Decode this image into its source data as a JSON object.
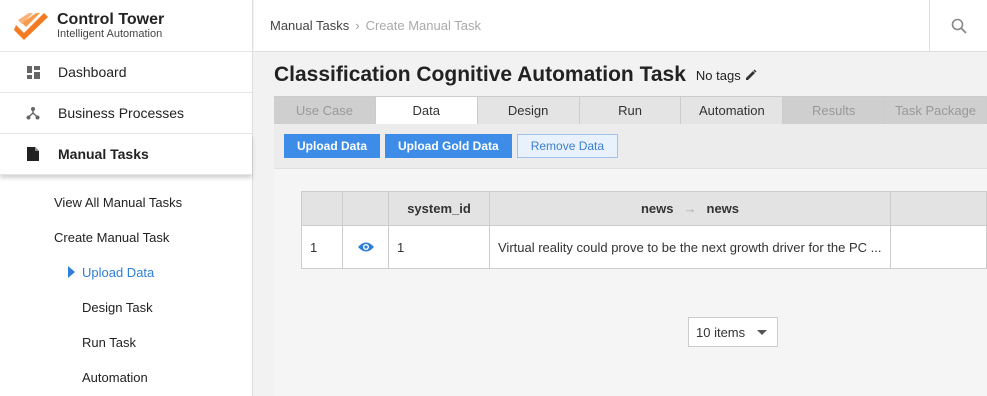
{
  "brand": {
    "name": "Control Tower",
    "tagline": "Intelligent Automation"
  },
  "nav": [
    {
      "label": "Dashboard",
      "icon": "dashboard-icon"
    },
    {
      "label": "Business Processes",
      "icon": "process-icon"
    },
    {
      "label": "Manual Tasks",
      "icon": "document-icon"
    }
  ],
  "subnav": {
    "view_all": "View All Manual Tasks",
    "create": "Create Manual Task",
    "upload": "Upload Data",
    "design": "Design Task",
    "run": "Run Task",
    "automation": "Automation"
  },
  "breadcrumb": {
    "root": "Manual Tasks",
    "current": "Create Manual Task"
  },
  "page": {
    "title": "Classification Cognitive Automation Task",
    "tags": "No tags"
  },
  "tabs": [
    "Use Case",
    "Data",
    "Design",
    "Run",
    "Automation",
    "Results",
    "Task Package"
  ],
  "buttons": {
    "upload": "Upload Data",
    "upload_gold": "Upload Gold Data",
    "remove": "Remove Data"
  },
  "grid": {
    "headers": {
      "id": "system_id",
      "from": "news",
      "to": "news"
    },
    "rows": [
      {
        "index": "1",
        "system_id": "1",
        "news": "Virtual reality could prove to be the next growth driver for the PC ..."
      }
    ]
  },
  "pager": {
    "page_size": "10 items"
  },
  "colors": {
    "accent": "#3c8ce8",
    "link": "#2f7fd8",
    "logo": "#f47b20"
  }
}
